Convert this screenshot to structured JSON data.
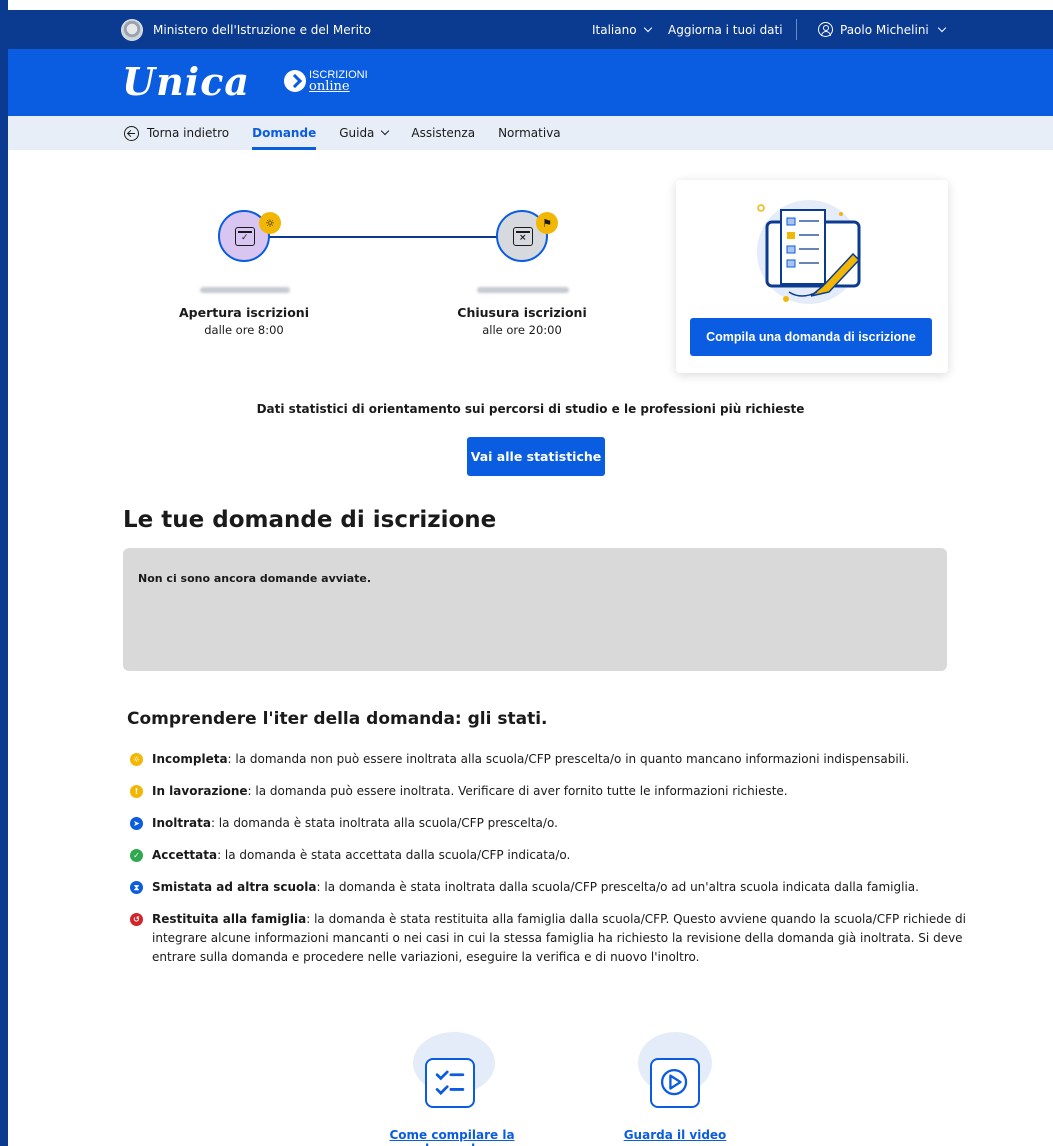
{
  "topbar": {
    "ministry": "Ministero dell'Istruzione e del Merito",
    "language": "Italiano",
    "update_data": "Aggiorna i tuoi dati",
    "user_name": "Paolo Michelini"
  },
  "brand": {
    "logo": "Unica",
    "iscrizioni_top": "ISCRIZIONI",
    "iscrizioni_bottom": "online"
  },
  "nav": {
    "back": "Torna indietro",
    "items": [
      "Domande",
      "Guida",
      "Assistenza",
      "Normativa"
    ],
    "active": "Domande"
  },
  "timeline": {
    "open": {
      "label": "Apertura iscrizioni",
      "sub": "dalle ore 8:00"
    },
    "close": {
      "label": "Chiusura iscrizioni",
      "sub": "alle ore 20:00"
    }
  },
  "card": {
    "button": "Compila una domanda di iscrizione"
  },
  "stats": {
    "text": "Dati statistici di orientamento sui percorsi di studio e le professioni più richieste",
    "button": "Vai alle statistiche"
  },
  "applications": {
    "title": "Le tue domande di iscrizione",
    "empty": "Non ci sono ancora domande avviate."
  },
  "states_section": {
    "title": "Comprendere l'iter della domanda: gli stati.",
    "states": [
      {
        "name": "Incompleta",
        "text": ": la domanda non può essere inoltrata alla scuola/CFP prescelta/o in quanto mancano informazioni indispensabili.",
        "color": "#f2b705",
        "glyph": "☼"
      },
      {
        "name": "In lavorazione",
        "text": ": la domanda può essere inoltrata. Verificare di aver fornito tutte le informazioni richieste.",
        "color": "#f2b705",
        "glyph": "!"
      },
      {
        "name": "Inoltrata",
        "text": ": la domanda è stata inoltrata alla scuola/CFP prescelta/o.",
        "color": "#0a5ce0",
        "glyph": "➤"
      },
      {
        "name": "Accettata",
        "text": ": la domanda è stata accettata dalla scuola/CFP indicata/o.",
        "color": "#2fa84f",
        "glyph": "✓"
      },
      {
        "name": "Smistata ad altra scuola",
        "text": ": la domanda è stata inoltrata dalla scuola/CFP prescelta/o ad un'altra scuola indicata dalla famiglia.",
        "color": "#0a5ce0",
        "glyph": "⧗"
      },
      {
        "name": "Restituita alla famiglia",
        "text": ": la domanda è stata restituita alla famiglia dalla scuola/CFP. Questo avviene quando la scuola/CFP richiede di integrare alcune informazioni mancanti o nei casi in cui la stessa famiglia ha richiesto la revisione della domanda già inoltrata. Si deve entrare sulla domanda e procedere nelle variazioni, eseguire la verifica e di nuovo l'inoltro.",
        "color": "#d0262a",
        "glyph": "↺"
      }
    ]
  },
  "resources": {
    "guide_link": "Come compilare la domanda",
    "video_link": "Guarda il video"
  }
}
